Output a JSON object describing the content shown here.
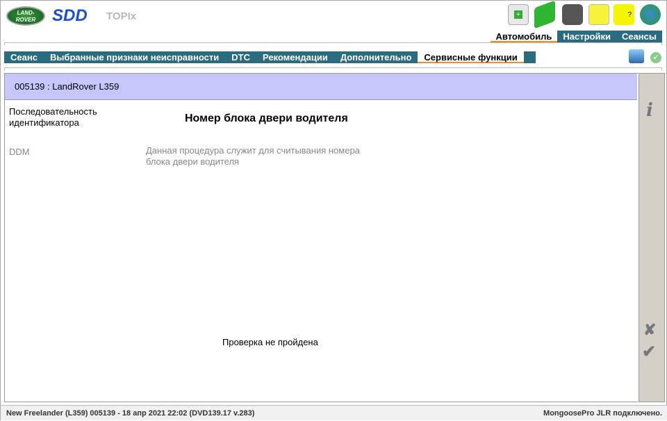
{
  "header": {
    "logo": "LAND ROVER",
    "app": "SDD",
    "topix": "TOPIx"
  },
  "top_tabs": [
    "Автомобиль",
    "Настройки",
    "Сеансы"
  ],
  "tabs": [
    "Сеанс",
    "Выбранные признаки неисправности",
    "DTC",
    "Рекомендации",
    "Дополнительно",
    "Сервисные функции"
  ],
  "vehicle": "005139 : LandRover L359",
  "content": {
    "seq_label": "Последовательность идентификатора",
    "title": "Номер блока двери водителя",
    "module": "DDM",
    "description": "Данная процедура служит для считывания номера блока двери водителя",
    "result": "Проверка не пройдена"
  },
  "status": {
    "left": "New Freelander (L359) 005139 - 18 апр 2021 22:02 (DVD139.17 v.283)",
    "right": "MongoosePro JLR подключено."
  }
}
